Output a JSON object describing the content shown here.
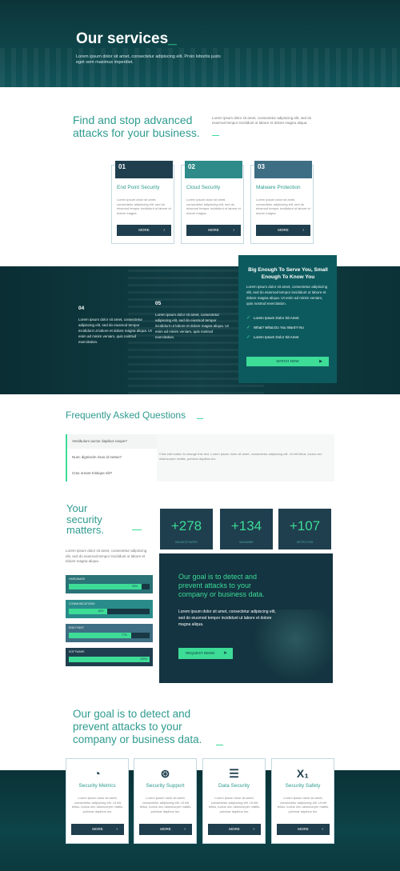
{
  "hero": {
    "title": "Our services",
    "title_suffix": "_",
    "subtitle": "Lorem ipsum dolor sit amet, consectetur adipiscing elit. Proin lobortis justo eget sem maximus imperdiet."
  },
  "find": {
    "title": "Find and stop advanced attacks for your business.",
    "text": "Lorem ipsum dolor sit amet, consectetur adipiscing elit, sed do eiusmod tempor incididunt ut labore et dolore magna aliqua."
  },
  "cards_top": [
    {
      "num": "01",
      "title": "End Point Security",
      "text": "Lorem ipsum dolor sit amet, consectetur adipiscing elit, sed do eiusmod tempor incididunt ut labore et dolore magna.",
      "more": "MORE",
      "color": "#1f3f4e"
    },
    {
      "num": "02",
      "title": "Cloud Security",
      "text": "Lorem ipsum dolor sit amet, consectetur adipiscing elit, sed do eiusmod tempor incididunt ut labore et dolore magna.",
      "more": "MORE",
      "color": "#2e8b8a"
    },
    {
      "num": "03",
      "title": "Malware Protection",
      "text": "Lorem ipsum dolor sit amet, consectetur adipiscing elit, sed do eiusmod tempor incididunt ut labore et dolore magna.",
      "more": "MORE",
      "color": "#3e6e83"
    }
  ],
  "band": {
    "n04": "04",
    "t04": "Lorem ipsum dolor sit amet, consectetur adipiscing elit, sed do eiusmod tempor incididunt ut labore et dolore magna aliqua. Ut enim ad minim veniam, quis nostrud exercitation.",
    "n05": "05",
    "t05": "Lorem ipsum dolor sit amet, consectetur adipiscing elit, sed do eiusmod tempor incididunt ut labore et dolore magna aliqua. Ut enim ad minim veniam, quis nostrud exercitation."
  },
  "bigbox": {
    "heading": "Big Enough To Serve You, Small Enough To Know You",
    "text": "Lorem ipsum dolor sit amet, consectetur adipiscing elit, sed do eiusmod tempor incididunt ut labore et dolore magna aliqua. Ut enim ad minim veniam, quis nostrud exercitation.",
    "checks": [
      "Lorem Ipsum Dolor Sit Amet.",
      "What? What Do You Want?! No",
      "Lorem Ipsum Dolor Sit Amet"
    ],
    "button": "WATCH NOW"
  },
  "faq": {
    "title": "Frequently Asked Questions",
    "questions": [
      "Vestibulum auctor dapibus neque?",
      "Nunc dignissim risus id metus?",
      "Cras ornare tristique elit?"
    ],
    "answer": "Click edit button to change this text. Lorem ipsum dolor sit amet, consectetur adipiscing elit. Ut elit tellus, luctus nec ullamcorper mattis, pulvinar dapibus leo."
  },
  "matters": {
    "title": "Your security matters.",
    "text": "Lorem ipsum dolor sit amet, consectetur adipiscing elit, sed do eiusmod tempor incididunt ut labore et dolore magna aliqua.",
    "stats": [
      {
        "value": "+278",
        "label": "BOUNCE RATES"
      },
      {
        "value": "+134",
        "label": "MALWARE"
      },
      {
        "value": "+107",
        "label": "DETECTION"
      }
    ],
    "bars": [
      {
        "label": "HARDWARE",
        "percent": 90,
        "pct_label": "90%"
      },
      {
        "label": "COMMUNICATIONS",
        "percent": 48,
        "pct_label": "48%"
      },
      {
        "label": "END POINT",
        "percent": 77,
        "pct_label": "77%"
      },
      {
        "label": "SOFTWARE",
        "percent": 100,
        "pct_label": "100%"
      }
    ]
  },
  "goal": {
    "heading": "Our goal is to detect and prevent attacks to your company or business data.",
    "text": "Lorem ipsum dolor sit amet, consectetur adipiscing elit, sed do eiusmod tempor incididunt ut labore et dolore magna aliqua.",
    "button": "REQUEST DEMO"
  },
  "bottom": {
    "title": "Our goal is to detect and prevent attacks to your company or business data."
  },
  "cards_bottom": [
    {
      "icon": "gauge-icon",
      "glyph": "◔",
      "title": "Security Metrics",
      "text": "Lorem ipsum dolor sit amet, consectetur adipiscing elit. Ut elit tellus, luctus nec ullamcorper mattis, pulvinar dapibus leo.",
      "more": "MORE"
    },
    {
      "icon": "lifebuoy-icon",
      "glyph": "⊛",
      "title": "Security Support",
      "text": "Lorem ipsum dolor sit amet, consectetur adipiscing elit. Ut elit tellus, luctus nec ullamcorper mattis, pulvinar dapibus leo.",
      "more": "MORE"
    },
    {
      "icon": "stack-icon",
      "glyph": "☰",
      "title": "Data Security",
      "text": "Lorem ipsum dolor sit amet, consectetur adipiscing elit. Ut elit tellus, luctus nec ullamcorper mattis, pulvinar dapibus leo.",
      "more": "MORE"
    },
    {
      "icon": "subscript-icon",
      "glyph": "X₁",
      "title": "Security Safety",
      "text": "Lorem ipsum dolor sit amet, consectetur adipiscing elit. Ut elit tellus, luctus nec ullamcorper mattis, pulvinar dapibus leo.",
      "more": "MORE"
    }
  ],
  "colors": {
    "accent": "#3ddc97",
    "teal": "#2e9b8f",
    "navy": "#1f3f4e"
  }
}
